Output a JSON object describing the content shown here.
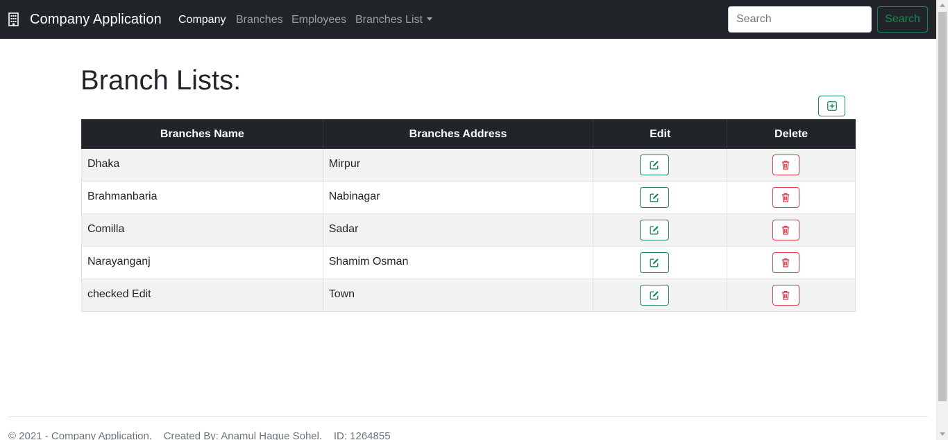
{
  "navbar": {
    "brand_icon": "building-icon",
    "brand": "Company Application",
    "links": [
      {
        "label": "Company",
        "active": true
      },
      {
        "label": "Branches",
        "active": false
      },
      {
        "label": "Employees",
        "active": false
      },
      {
        "label": "Branches List",
        "active": false,
        "dropdown": true
      }
    ],
    "search": {
      "placeholder": "Search",
      "value": "",
      "button_label": "Search"
    }
  },
  "main": {
    "title": "Branch Lists:",
    "add_icon": "plus-square-icon",
    "table": {
      "headers": [
        "Branches Name",
        "Branches Address",
        "Edit",
        "Delete"
      ],
      "rows": [
        {
          "name": "Dhaka",
          "address": "Mirpur"
        },
        {
          "name": "Brahmanbaria",
          "address": "Nabinagar"
        },
        {
          "name": "Comilla",
          "address": "Sadar"
        },
        {
          "name": "Narayanganj",
          "address": "Shamim Osman"
        },
        {
          "name": "checked Edit",
          "address": "Town"
        }
      ],
      "edit_icon": "pencil-square-icon",
      "delete_icon": "trash-icon"
    }
  },
  "footer": {
    "text": "© 2021 - Company Application.    Created By: Anamul Haque Sohel.    ID: 1264855"
  },
  "colors": {
    "navbar_bg": "#212529",
    "success": "#198754",
    "danger": "#dc3545"
  }
}
